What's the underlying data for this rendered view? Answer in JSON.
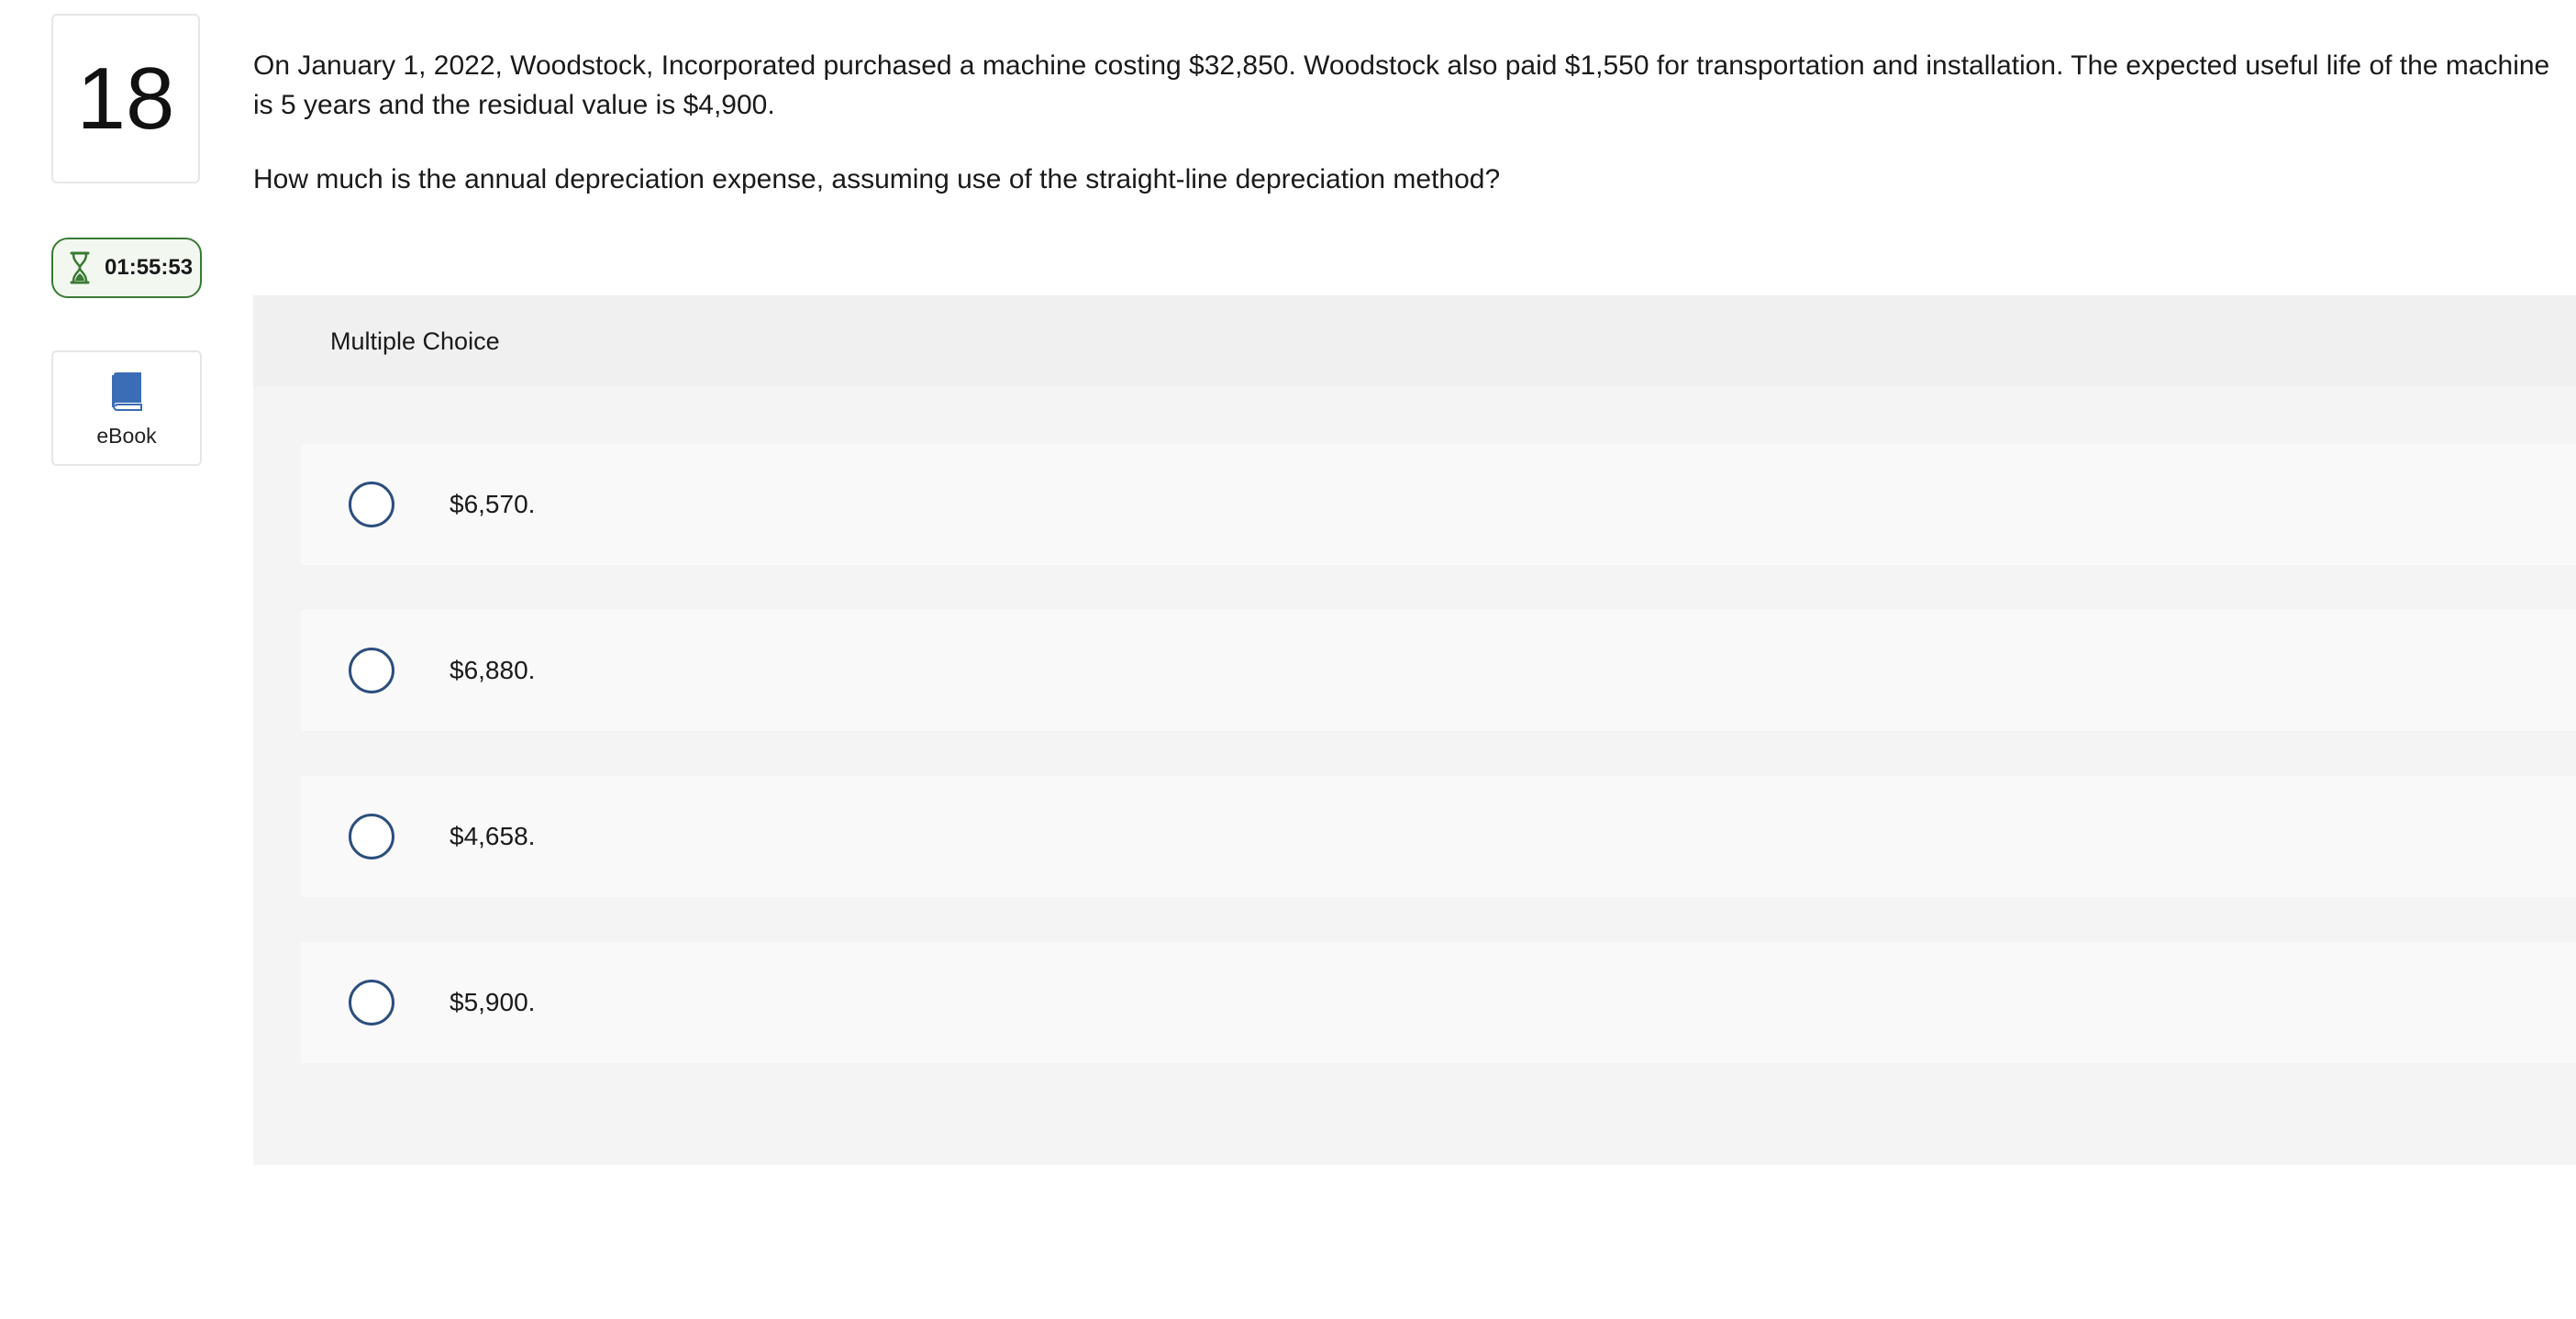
{
  "question": {
    "number": "18",
    "paragraph1": "On January 1, 2022, Woodstock, Incorporated purchased a machine costing $32,850. Woodstock also paid $1,550 for transportation and installation. The expected useful life of the machine is 5 years and the residual value is $4,900.",
    "paragraph2": "How much is the annual depreciation expense, assuming use of the straight-line depreciation method?"
  },
  "timer": {
    "icon": "hourglass-icon",
    "time": "01:55:53",
    "color": "#3a7a33"
  },
  "ebook": {
    "icon": "book-icon",
    "label": "eBook",
    "color": "#3a6db5"
  },
  "multiple_choice": {
    "header": "Multiple Choice",
    "options": [
      {
        "label": "$6,570."
      },
      {
        "label": "$6,880."
      },
      {
        "label": "$4,658."
      },
      {
        "label": "$5,900."
      }
    ]
  }
}
